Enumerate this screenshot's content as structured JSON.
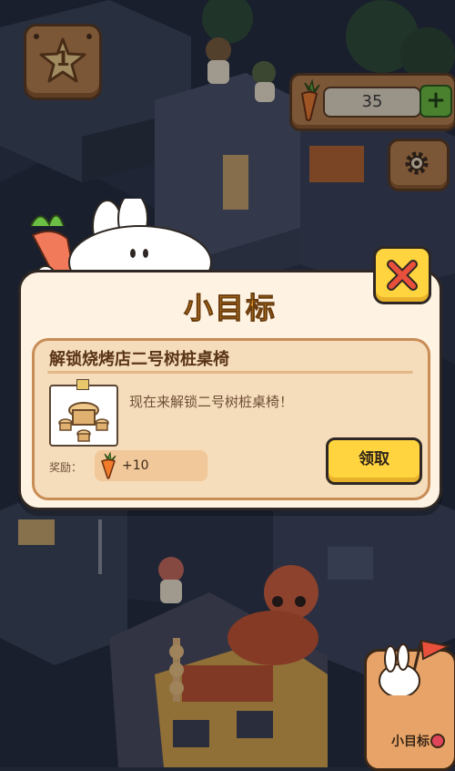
{
  "hud": {
    "level": "1",
    "carrot_count": "35",
    "add_symbol": "+"
  },
  "dialog": {
    "title": "小目标",
    "task_title": "解锁烧烤店二号树桩桌椅",
    "task_description": "现在来解锁二号树桩桌椅！",
    "reward_label": "奖励：",
    "reward_value": "+10",
    "claim_label": "领取"
  },
  "goal_button": {
    "label": "小目标"
  },
  "colors": {
    "accent_yellow": "#ffd43f",
    "title_orange": "#f7a321",
    "dialog_bg": "#fef3e2",
    "panel_bg": "#f5dcba",
    "wood": "#b9804a",
    "plus_green": "#6cc13c"
  }
}
